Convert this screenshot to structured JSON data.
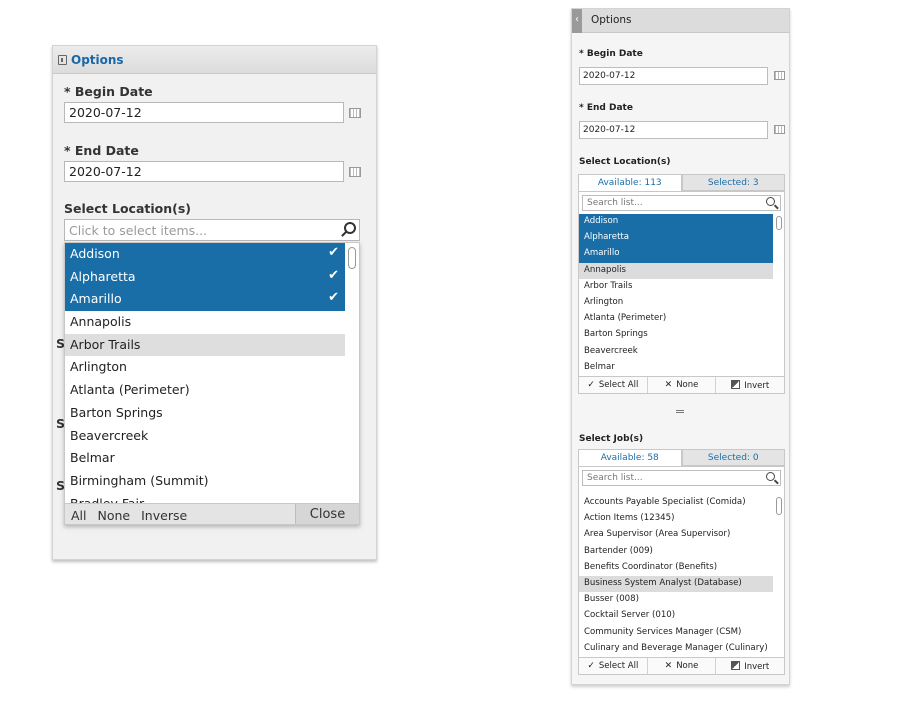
{
  "left": {
    "title": "Options",
    "begin_label": "* Begin Date",
    "begin_value": "2020-07-12",
    "end_label": "* End Date",
    "end_value": "2020-07-12",
    "location_label": "Select Location(s)",
    "search_placeholder": "Click to select items...",
    "ghost_letters": [
      "S",
      "S",
      "S"
    ],
    "items": [
      {
        "label": "Addison",
        "selected": true
      },
      {
        "label": "Alpharetta",
        "selected": true
      },
      {
        "label": "Amarillo",
        "selected": true
      },
      {
        "label": "Annapolis"
      },
      {
        "label": "Arbor Trails",
        "hover": true
      },
      {
        "label": "Arlington"
      },
      {
        "label": "Atlanta (Perimeter)"
      },
      {
        "label": "Barton Springs"
      },
      {
        "label": "Beavercreek"
      },
      {
        "label": "Belmar"
      },
      {
        "label": "Birmingham (Summit)"
      },
      {
        "label": "Bradley Fair"
      }
    ],
    "footer": {
      "all": "All",
      "none": "None",
      "inverse": "Inverse",
      "close": "Close"
    }
  },
  "right": {
    "title": "Options",
    "begin_label": "* Begin Date",
    "begin_value": "2020-07-12",
    "end_label": "* End Date",
    "end_value": "2020-07-12",
    "location": {
      "label": "Select Location(s)",
      "tab_available": "Available: 113",
      "tab_selected": "Selected: 3",
      "search_placeholder": "Search list...",
      "items": [
        {
          "label": "Addison",
          "selected": true
        },
        {
          "label": "Alpharetta",
          "selected": true
        },
        {
          "label": "Amarillo",
          "selected": true
        },
        {
          "label": "Annapolis",
          "hover": true
        },
        {
          "label": "Arbor Trails"
        },
        {
          "label": "Arlington"
        },
        {
          "label": "Atlanta (Perimeter)"
        },
        {
          "label": "Barton Springs"
        },
        {
          "label": "Beavercreek"
        },
        {
          "label": "Belmar"
        }
      ]
    },
    "job": {
      "label": "Select Job(s)",
      "tab_available": "Available: 58",
      "tab_selected": "Selected: 0",
      "search_placeholder": "Search list...",
      "items": [
        {
          "label": "Accounts Payable Specialist (Comida)"
        },
        {
          "label": "Action Items (12345)"
        },
        {
          "label": "Area Supervisor (Area Supervisor)"
        },
        {
          "label": "Bartender (009)"
        },
        {
          "label": "Benefits Coordinator (Benefits)"
        },
        {
          "label": "Business System Analyst (Database)",
          "hover": true
        },
        {
          "label": "Busser (008)"
        },
        {
          "label": "Cocktail Server (010)"
        },
        {
          "label": "Community Services Manager (CSM)"
        },
        {
          "label": "Culinary and Beverage Manager (Culinary)"
        }
      ]
    },
    "footer": {
      "select_all": "Select All",
      "none": "None",
      "invert": "Invert"
    }
  },
  "colors": {
    "accent": "#1a6ea8",
    "title_blue": "#1a67a8",
    "hover": "#dedede"
  }
}
